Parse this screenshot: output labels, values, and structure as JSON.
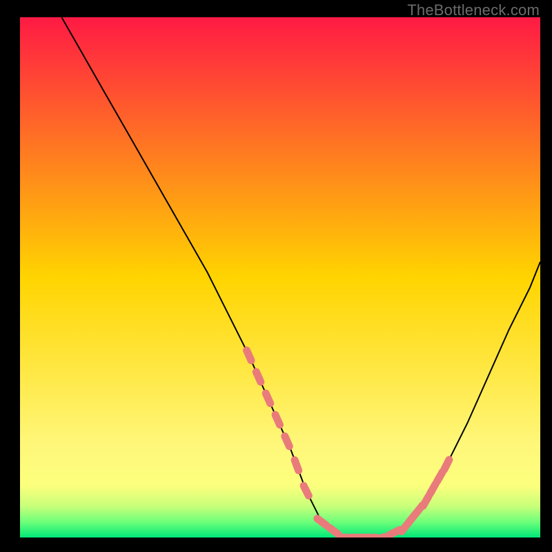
{
  "attribution": "TheBottleneck.com",
  "chart_data": {
    "type": "line",
    "title": "",
    "xlabel": "",
    "ylabel": "",
    "xlim": [
      0,
      100
    ],
    "ylim": [
      0,
      100
    ],
    "grid": false,
    "series": [
      {
        "name": "bottleneck-curve",
        "x": [
          8,
          12,
          16,
          20,
          24,
          28,
          32,
          36,
          40,
          44,
          48,
          52,
          55,
          58,
          62,
          66,
          70,
          74,
          78,
          82,
          86,
          90,
          94,
          98,
          100
        ],
        "y": [
          100,
          93,
          86,
          79,
          72,
          65,
          58,
          51,
          43,
          35,
          26,
          17,
          9,
          3,
          0,
          0,
          0,
          2,
          7,
          14,
          22,
          31,
          40,
          48,
          53
        ]
      }
    ],
    "highlight_segments": [
      {
        "name": "left-descent-markers",
        "x_range": [
          44,
          55
        ],
        "y_range": [
          28,
          8
        ]
      },
      {
        "name": "valley-floor-markers",
        "x_range": [
          58,
          72
        ],
        "y_range": [
          1,
          1
        ]
      },
      {
        "name": "right-ascent-markers",
        "x_range": [
          74,
          82
        ],
        "y_range": [
          4,
          17
        ]
      }
    ],
    "gradient": {
      "stops": [
        {
          "offset": 0.0,
          "color": "#ff1a44"
        },
        {
          "offset": 0.5,
          "color": "#ffd400"
        },
        {
          "offset": 0.82,
          "color": "#fff77a"
        },
        {
          "offset": 0.9,
          "color": "#fcff7d"
        },
        {
          "offset": 0.94,
          "color": "#c8ff7a"
        },
        {
          "offset": 0.97,
          "color": "#6eff7a"
        },
        {
          "offset": 1.0,
          "color": "#00e878"
        }
      ]
    },
    "marker_color": "#e97b7b",
    "curve_color": "#000000"
  }
}
